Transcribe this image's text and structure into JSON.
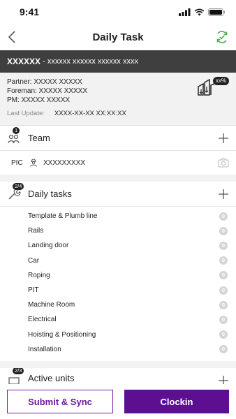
{
  "status_bar": {
    "time": "9:41"
  },
  "nav": {
    "title": "Daily Task"
  },
  "banner": {
    "code": "XXXXXX",
    "separator": " - ",
    "name": "xxxxxx xxxxxx xxxxxx xxxx"
  },
  "info": {
    "partner": "Partner: XXXXX XXXXX",
    "foreman": "Foreman: XXXXX XXXXX",
    "pm": "PM: XXXXX XXXXX",
    "last_update_label": "Last Update:",
    "last_update_value": "XXXX-XX-XX XX:XX:XX",
    "progress_badge": "xx%"
  },
  "team": {
    "title": "Team",
    "badge": "1",
    "pic_label": "PIC",
    "pic_name": "XXXXXXXXX"
  },
  "daily_tasks": {
    "title": "Daily tasks",
    "badge": "2/4",
    "items": [
      {
        "label": "Template & Plumb line",
        "count": "0"
      },
      {
        "label": "Rails",
        "count": "0"
      },
      {
        "label": "Landing door",
        "count": "0"
      },
      {
        "label": "Car",
        "count": "0"
      },
      {
        "label": "Roping",
        "count": "0"
      },
      {
        "label": "PIT",
        "count": "0"
      },
      {
        "label": "Machine Room",
        "count": "0"
      },
      {
        "label": "Electrical",
        "count": "0"
      },
      {
        "label": "Hoisting & Positioning",
        "count": "0"
      },
      {
        "label": "Installation",
        "count": "0"
      }
    ]
  },
  "active_units": {
    "title": "Active units",
    "badge": "2/3"
  },
  "actions": {
    "submit_label": "Submit & Sync",
    "clockin_label": "Clockin"
  },
  "colors": {
    "primary": "#5d0f91",
    "sync_green": "#4caf50",
    "banner_bg": "#3f3f3f"
  }
}
